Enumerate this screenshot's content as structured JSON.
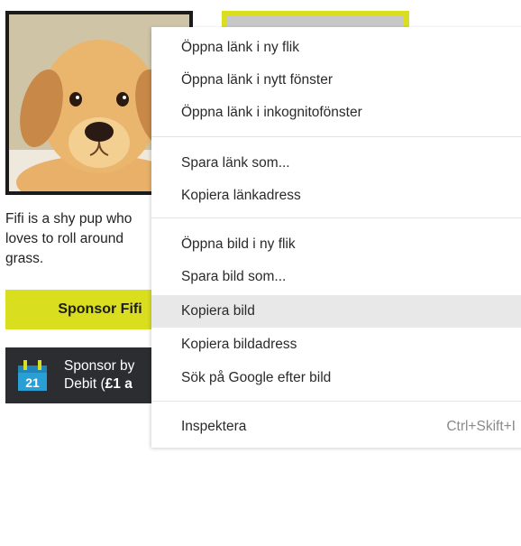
{
  "page": {
    "description": "Fifi is a shy pup who loves to roll around grass.",
    "description_line1": "Fifi is a shy pup who",
    "description_line2": "loves to roll around",
    "description_line3": "grass.",
    "sponsor_button": "Sponsor Fifi",
    "debit_line1": "Sponsor by",
    "debit_line2_prefix": "Debit (",
    "debit_line2_bold": "£1 a",
    "calendar_icon_day": "21",
    "colors": {
      "accent": "#d9de1e",
      "dark_panel": "#2b2d31",
      "calendar_icon": "#2a9fd6"
    }
  },
  "context_menu": {
    "groups": [
      {
        "items": [
          {
            "label": "Öppna länk i ny flik"
          },
          {
            "label": "Öppna länk i nytt fönster"
          },
          {
            "label": "Öppna länk i inkognitofönster"
          }
        ]
      },
      {
        "items": [
          {
            "label": "Spara länk som..."
          },
          {
            "label": "Kopiera länkadress"
          }
        ]
      },
      {
        "items": [
          {
            "label": "Öppna bild i ny flik"
          },
          {
            "label": "Spara bild som..."
          },
          {
            "label": "Kopiera bild",
            "highlighted": true
          },
          {
            "label": "Kopiera bildadress"
          },
          {
            "label": "Sök på Google efter bild"
          }
        ]
      },
      {
        "items": [
          {
            "label": "Inspektera",
            "shortcut": "Ctrl+Skift+I"
          }
        ]
      }
    ]
  }
}
